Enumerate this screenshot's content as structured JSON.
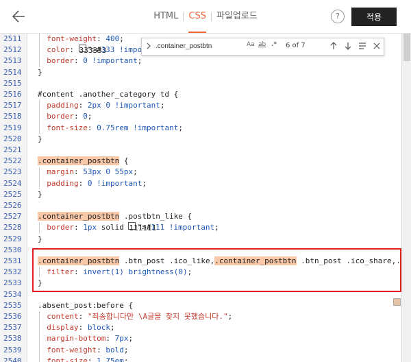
{
  "header": {
    "tabs": [
      {
        "label": "HTML",
        "active": false
      },
      {
        "label": "CSS",
        "active": true
      },
      {
        "label": "파일업로드",
        "active": false
      }
    ],
    "help_label": "?",
    "apply_label": "적용"
  },
  "find": {
    "query": ".container_postbtn",
    "match_case": "Aa",
    "whole_word": "ab",
    "regex": ".*",
    "count": "6 of 7"
  },
  "editor": {
    "lines": [
      {
        "n": "2511",
        "code": "  font-weight: 400;"
      },
      {
        "n": "2512",
        "code": "  color: #333 !important;"
      },
      {
        "n": "2513",
        "code": "  border: 0 !important;"
      },
      {
        "n": "2514",
        "code": "}"
      },
      {
        "n": "2515",
        "code": ""
      },
      {
        "n": "2516",
        "code": "#content .another_category td {"
      },
      {
        "n": "2517",
        "code": "  padding: 2px 0 !important;"
      },
      {
        "n": "2518",
        "code": "  border: 0;"
      },
      {
        "n": "2519",
        "code": "  font-size: 0.75rem !important;"
      },
      {
        "n": "2520",
        "code": "}"
      },
      {
        "n": "2521",
        "code": ""
      },
      {
        "n": "2522",
        "code": ".container_postbtn {"
      },
      {
        "n": "2523",
        "code": "  margin: 53px 0 55px;"
      },
      {
        "n": "2524",
        "code": "  padding: 0 !important;"
      },
      {
        "n": "2525",
        "code": "}"
      },
      {
        "n": "2526",
        "code": ""
      },
      {
        "n": "2527",
        "code": ".container_postbtn .postbtn_like {"
      },
      {
        "n": "2528",
        "code": "  border: 1px solid #111 !important;"
      },
      {
        "n": "2529",
        "code": "}"
      },
      {
        "n": "2530",
        "code": ""
      },
      {
        "n": "2531",
        "code": ".container_postbtn .btn_post .ico_like,.container_postbtn .btn_post .ico_share,.c"
      },
      {
        "n": "2532",
        "code": "  filter: invert(1) brightness(0);"
      },
      {
        "n": "2533",
        "code": "}"
      },
      {
        "n": "2534",
        "code": ""
      },
      {
        "n": "2535",
        "code": ".absent_post:before {"
      },
      {
        "n": "2536",
        "code": "  content: \"죄송합니다만 \\A글을 찾지 못했습니다.\";"
      },
      {
        "n": "2537",
        "code": "  display: block;"
      },
      {
        "n": "2538",
        "code": "  margin-bottom: 7px;"
      },
      {
        "n": "2539",
        "code": "  font-weight: bold;"
      },
      {
        "n": "2540",
        "code": "  font-size: 1.75em;"
      }
    ]
  },
  "colors": {
    "accent": "#f0643a",
    "highlight": "#f9c8a8",
    "swatch_333": "#333333",
    "swatch_111": "#111111",
    "red_box": "#e02020"
  }
}
